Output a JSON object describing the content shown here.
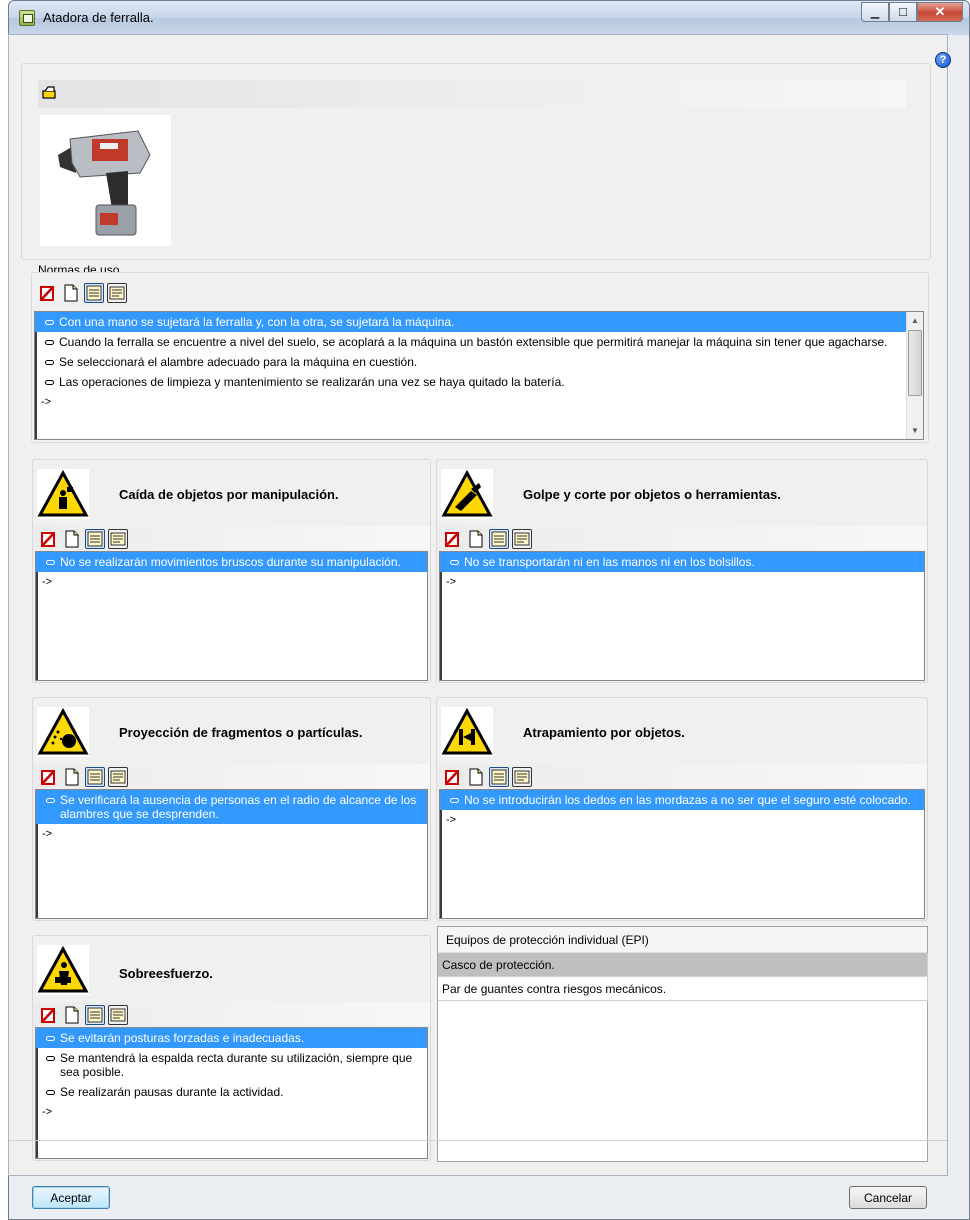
{
  "window": {
    "title": "Atadora de ferralla.",
    "controls": [
      "minimize",
      "maximize",
      "close"
    ]
  },
  "help_label": "?",
  "normas": {
    "label": "Normas de uso",
    "items": [
      {
        "text": "Con una mano se sujetará la ferralla y, con la otra, se sujetará la máquina.",
        "selected": true
      },
      {
        "text": "Cuando la ferralla se encuentre a nivel del suelo, se acoplará a la máquina un bastón extensible que permitirá manejar la máquina sin tener que agacharse.",
        "selected": false
      },
      {
        "text": "Se seleccionará el alambre adecuado para la máquina en cuestión.",
        "selected": false
      },
      {
        "text": "Las operaciones de limpieza y mantenimiento se realizarán una vez se haya quitado la batería.",
        "selected": false
      }
    ],
    "add_row": "->"
  },
  "risks": [
    {
      "title": "Caída de objetos por manipulación.",
      "icon": "falling-objects-warning-icon",
      "items": [
        "No se realizarán movimientos bruscos durante su manipulación."
      ],
      "add_row": "->"
    },
    {
      "title": "Golpe y corte por objetos o herramientas.",
      "icon": "cut-warning-icon",
      "items": [
        "No se transportarán ni en las manos ni en los bolsillos."
      ],
      "add_row": "->"
    },
    {
      "title": "Proyección de fragmentos o partículas.",
      "icon": "particles-warning-icon",
      "items": [
        "Se verificará la ausencia de personas en el radio de alcance de los alambres que se desprenden."
      ],
      "add_row": "->"
    },
    {
      "title": "Atrapamiento por objetos.",
      "icon": "entrapment-warning-icon",
      "items": [
        "No se introducirán los dedos en las mordazas a no ser que el seguro esté colocado."
      ],
      "add_row": "->"
    },
    {
      "title": "Sobreesfuerzo.",
      "icon": "overexertion-warning-icon",
      "items": [
        "Se evitarán posturas forzadas e inadecuadas.",
        "Se mantendrá la espalda recta durante su utilización, siempre que sea posible.",
        "Se realizarán pausas durante la actividad."
      ],
      "add_row": "->"
    }
  ],
  "epi": {
    "header": "Equipos de protección individual (EPI)",
    "items": [
      "Casco de protección.",
      "Par de guantes contra riesgos mecánicos."
    ]
  },
  "buttons": {
    "accept": "Aceptar",
    "cancel": "Cancelar"
  },
  "colors": {
    "selection": "#3399ff",
    "warning_yellow": "#ffd800",
    "epi_selection": "#bfbfbf"
  }
}
